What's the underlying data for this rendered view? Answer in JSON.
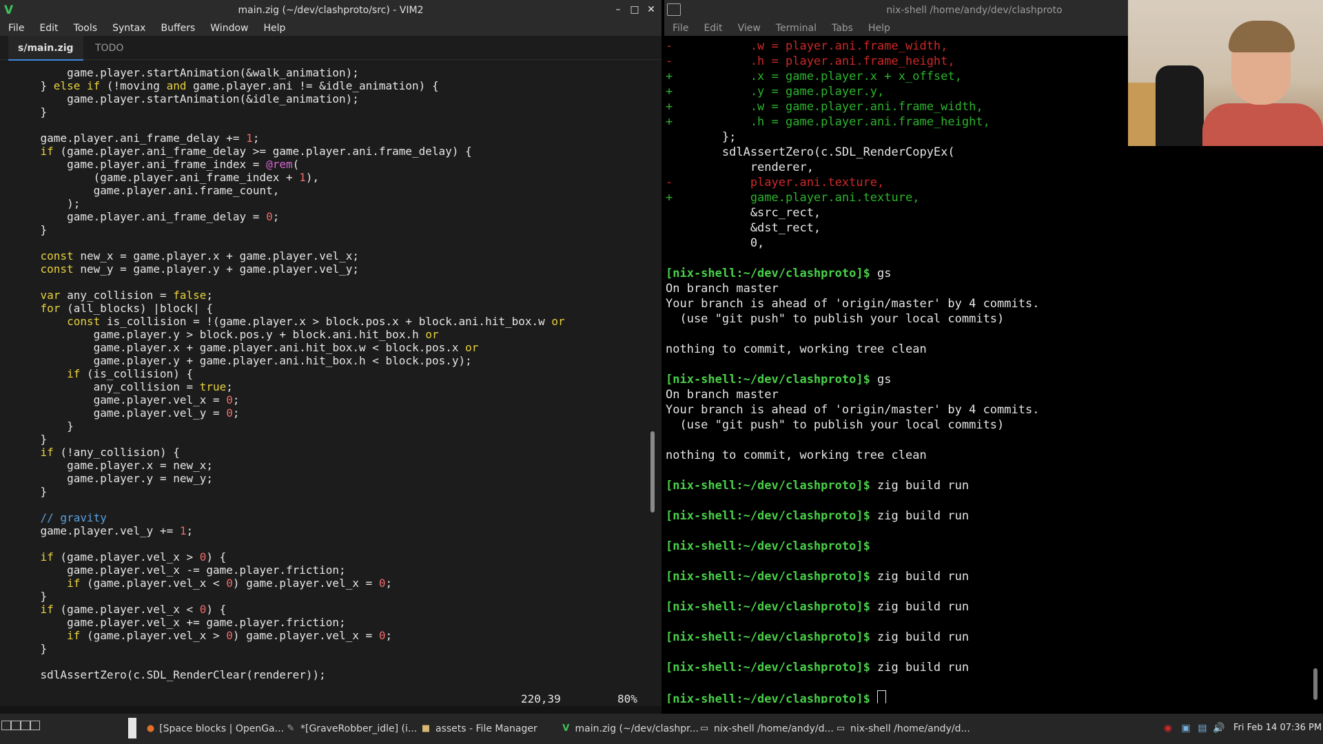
{
  "vim": {
    "title": "main.zig (~/dev/clashproto/src) - VIM2",
    "menu": [
      "File",
      "Edit",
      "Tools",
      "Syntax",
      "Buffers",
      "Window",
      "Help"
    ],
    "tabs": [
      {
        "label": "s/main.zig",
        "active": true
      },
      {
        "label": "TODO",
        "active": false
      }
    ],
    "code_lines": [
      "        game.player.startAnimation(&walk_animation);",
      "    } else if (!moving and game.player.ani != &idle_animation) {",
      "        game.player.startAnimation(&idle_animation);",
      "    }",
      "",
      "    game.player.ani_frame_delay += 1;",
      "    if (game.player.ani_frame_delay >= game.player.ani.frame_delay) {",
      "        game.player.ani_frame_index = @rem(",
      "            (game.player.ani_frame_index + 1),",
      "            game.player.ani.frame_count,",
      "        );",
      "        game.player.ani_frame_delay = 0;",
      "    }",
      "",
      "    const new_x = game.player.x + game.player.vel_x;",
      "    const new_y = game.player.y + game.player.vel_y;",
      "",
      "    var any_collision = false;",
      "    for (all_blocks) |block| {",
      "        const is_collision = !(game.player.x > block.pos.x + block.ani.hit_box.w or",
      "            game.player.y > block.pos.y + block.ani.hit_box.h or",
      "            game.player.x + game.player.ani.hit_box.w < block.pos.x or",
      "            game.player.y + game.player.ani.hit_box.h < block.pos.y);",
      "        if (is_collision) {",
      "            any_collision = true;",
      "            game.player.vel_x = 0;",
      "            game.player.vel_y = 0;",
      "        }",
      "    }",
      "    if (!any_collision) {",
      "        game.player.x = new_x;",
      "        game.player.y = new_y;",
      "    }",
      "",
      "    // gravity",
      "    game.player.vel_y += 1;",
      "",
      "    if (game.player.vel_x > 0) {",
      "        game.player.vel_x -= game.player.friction;",
      "        if (game.player.vel_x < 0) game.player.vel_x = 0;",
      "    }",
      "    if (game.player.vel_x < 0) {",
      "        game.player.vel_x += game.player.friction;",
      "        if (game.player.vel_x > 0) game.player.vel_x = 0;",
      "    }",
      "",
      "    sdlAssertZero(c.SDL_RenderClear(renderer));"
    ],
    "cursor_position": "220,39",
    "scroll_percent": "80%"
  },
  "terminal": {
    "title": "nix-shell /home/andy/dev/clashproto",
    "menu": [
      "File",
      "Edit",
      "View",
      "Terminal",
      "Tabs",
      "Help"
    ],
    "lines": [
      {
        "kind": "del",
        "text": "-           .w = player.ani.frame_width,"
      },
      {
        "kind": "del",
        "text": "-           .h = player.ani.frame_height,"
      },
      {
        "kind": "add",
        "text": "+           .x = game.player.x + x_offset,"
      },
      {
        "kind": "add",
        "text": "+           .y = game.player.y,"
      },
      {
        "kind": "add",
        "text": "+           .w = game.player.ani.frame_width,"
      },
      {
        "kind": "add",
        "text": "+           .h = game.player.ani.frame_height,"
      },
      {
        "kind": "plain",
        "text": "        };"
      },
      {
        "kind": "plain",
        "text": "        sdlAssertZero(c.SDL_RenderCopyEx("
      },
      {
        "kind": "plain",
        "text": "            renderer,"
      },
      {
        "kind": "del",
        "text": "-           player.ani.texture,"
      },
      {
        "kind": "add",
        "text": "+           game.player.ani.texture,"
      },
      {
        "kind": "plain",
        "text": "            &src_rect,"
      },
      {
        "kind": "plain",
        "text": "            &dst_rect,"
      },
      {
        "kind": "plain",
        "text": "            0,"
      },
      {
        "kind": "plain",
        "text": ""
      },
      {
        "kind": "prompt",
        "prompt": "[nix-shell:~/dev/clashproto]$",
        "cmd": " gs"
      },
      {
        "kind": "plain",
        "text": "On branch master"
      },
      {
        "kind": "plain",
        "text": "Your branch is ahead of 'origin/master' by 4 commits."
      },
      {
        "kind": "plain",
        "text": "  (use \"git push\" to publish your local commits)"
      },
      {
        "kind": "plain",
        "text": ""
      },
      {
        "kind": "plain",
        "text": "nothing to commit, working tree clean"
      },
      {
        "kind": "plain",
        "text": ""
      },
      {
        "kind": "prompt",
        "prompt": "[nix-shell:~/dev/clashproto]$",
        "cmd": " gs"
      },
      {
        "kind": "plain",
        "text": "On branch master"
      },
      {
        "kind": "plain",
        "text": "Your branch is ahead of 'origin/master' by 4 commits."
      },
      {
        "kind": "plain",
        "text": "  (use \"git push\" to publish your local commits)"
      },
      {
        "kind": "plain",
        "text": ""
      },
      {
        "kind": "plain",
        "text": "nothing to commit, working tree clean"
      },
      {
        "kind": "plain",
        "text": ""
      },
      {
        "kind": "prompt",
        "prompt": "[nix-shell:~/dev/clashproto]$",
        "cmd": " zig build run"
      },
      {
        "kind": "plain",
        "text": ""
      },
      {
        "kind": "prompt",
        "prompt": "[nix-shell:~/dev/clashproto]$",
        "cmd": " zig build run"
      },
      {
        "kind": "plain",
        "text": ""
      },
      {
        "kind": "prompt",
        "prompt": "[nix-shell:~/dev/clashproto]$",
        "cmd": ""
      },
      {
        "kind": "plain",
        "text": ""
      },
      {
        "kind": "prompt",
        "prompt": "[nix-shell:~/dev/clashproto]$",
        "cmd": " zig build run"
      },
      {
        "kind": "plain",
        "text": ""
      },
      {
        "kind": "prompt",
        "prompt": "[nix-shell:~/dev/clashproto]$",
        "cmd": " zig build run"
      },
      {
        "kind": "plain",
        "text": ""
      },
      {
        "kind": "prompt",
        "prompt": "[nix-shell:~/dev/clashproto]$",
        "cmd": " zig build run"
      },
      {
        "kind": "plain",
        "text": ""
      },
      {
        "kind": "prompt",
        "prompt": "[nix-shell:~/dev/clashproto]$",
        "cmd": " zig build run"
      },
      {
        "kind": "plain",
        "text": ""
      },
      {
        "kind": "prompt",
        "prompt": "[nix-shell:~/dev/clashproto]$",
        "cmd": " ",
        "cursor": true
      }
    ]
  },
  "taskbar": {
    "items": [
      {
        "icon": "firefox-icon",
        "label": "[Space blocks | OpenGa..."
      },
      {
        "icon": "gimp-icon",
        "label": "*[GraveRobber_idle] (i..."
      },
      {
        "icon": "folder-icon",
        "label": "assets - File Manager"
      },
      {
        "icon": "vim-icon",
        "label": "main.zig (~/dev/clashpr..."
      },
      {
        "icon": "terminal-icon",
        "label": "nix-shell /home/andy/d..."
      },
      {
        "icon": "terminal-icon",
        "label": "nix-shell /home/andy/d..."
      }
    ],
    "clock": "Fri Feb 14 07:36 PM"
  },
  "colors": {
    "prompt": "#49d049",
    "diff_add": "#2cb52c",
    "diff_del": "#d02828",
    "keyword": "#e8d23c",
    "number": "#f06b6b",
    "builtin": "#d466d4",
    "comment": "#5aa0e0"
  }
}
